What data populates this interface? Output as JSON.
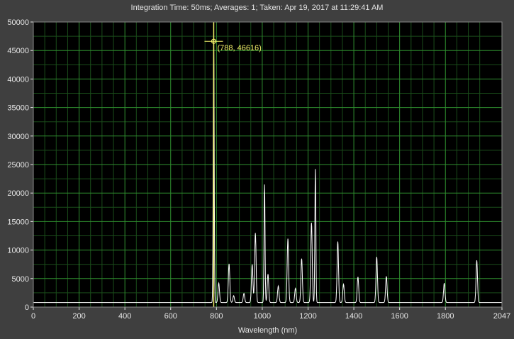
{
  "header": {
    "title": "Integration Time: 50ms;  Averages: 1;  Taken: Apr 19, 2017 at 11:29:41 AM"
  },
  "colors": {
    "background": "#3f3f3f",
    "plot_background": "#000000",
    "grid_major": "#2f8f2f",
    "grid_minor": "#1a4d1a",
    "spectrum": "#ffffff",
    "cursor": "#f3f06a",
    "text": "#e6e6e6"
  },
  "chart_data": {
    "type": "line",
    "xlabel": "Wavelength (nm)",
    "ylabel": "",
    "xlim": [
      0,
      2047
    ],
    "ylim": [
      0,
      50000
    ],
    "x_ticks": [
      0,
      200,
      400,
      600,
      800,
      1000,
      1200,
      1400,
      1600,
      1800,
      2047
    ],
    "y_ticks": [
      0,
      5000,
      10000,
      15000,
      20000,
      25000,
      30000,
      35000,
      40000,
      45000,
      50000
    ],
    "grid": true,
    "baseline": 800,
    "peaks": [
      {
        "x": 788,
        "y": 46616
      },
      {
        "x": 810,
        "y": 4200
      },
      {
        "x": 855,
        "y": 7600
      },
      {
        "x": 875,
        "y": 2000
      },
      {
        "x": 920,
        "y": 2400
      },
      {
        "x": 956,
        "y": 7500
      },
      {
        "x": 970,
        "y": 13000
      },
      {
        "x": 1010,
        "y": 21500
      },
      {
        "x": 1025,
        "y": 5800
      },
      {
        "x": 1070,
        "y": 3700
      },
      {
        "x": 1112,
        "y": 12000
      },
      {
        "x": 1145,
        "y": 3300
      },
      {
        "x": 1172,
        "y": 8500
      },
      {
        "x": 1215,
        "y": 14800
      },
      {
        "x": 1232,
        "y": 24200
      },
      {
        "x": 1330,
        "y": 11500
      },
      {
        "x": 1355,
        "y": 4000
      },
      {
        "x": 1418,
        "y": 5300
      },
      {
        "x": 1500,
        "y": 8800
      },
      {
        "x": 1542,
        "y": 5400
      },
      {
        "x": 1795,
        "y": 4200
      },
      {
        "x": 1937,
        "y": 8200
      }
    ],
    "cursor": {
      "x": 788,
      "y": 46616,
      "label": "(788, 46616)"
    }
  }
}
